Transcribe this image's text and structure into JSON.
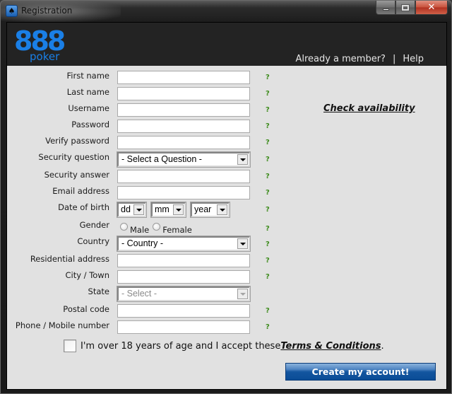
{
  "window": {
    "title": "Registration",
    "icon": "spade-icon",
    "controls": {
      "minimize": "minimize",
      "maximize": "maximize",
      "close": "close"
    }
  },
  "header": {
    "logo_number": "888",
    "logo_word": "poker",
    "brand_color": "#1a7fe6",
    "already_member": "Already a member?",
    "separator": "|",
    "help": "Help"
  },
  "form": {
    "help_glyph": "?",
    "help_color": "#3f8c1e",
    "check_availability": "Check availability",
    "fields": {
      "first_name": {
        "label": "First name",
        "value": ""
      },
      "last_name": {
        "label": "Last name",
        "value": ""
      },
      "username": {
        "label": "Username",
        "value": ""
      },
      "password": {
        "label": "Password",
        "value": ""
      },
      "verify_password": {
        "label": "Verify password",
        "value": ""
      },
      "security_question": {
        "label": "Security question",
        "selected": "- Select a Question -"
      },
      "security_answer": {
        "label": "Security answer",
        "value": ""
      },
      "email": {
        "label": "Email address",
        "value": ""
      },
      "dob": {
        "label": "Date of birth",
        "day": "dd",
        "month": "mm",
        "year": "year"
      },
      "gender": {
        "label": "Gender",
        "options": [
          "Male",
          "Female"
        ],
        "selected": null
      },
      "country": {
        "label": "Country",
        "selected": "- Country -"
      },
      "address": {
        "label": "Residential address",
        "value": ""
      },
      "city": {
        "label": "City / Town",
        "value": ""
      },
      "state": {
        "label": "State",
        "selected": "- Select -",
        "disabled": true
      },
      "postal_code": {
        "label": "Postal code",
        "value": ""
      },
      "phone": {
        "label": "Phone / Mobile number",
        "value": ""
      }
    },
    "terms": {
      "checked": false,
      "text": "I'm over 18 years of age and I accept these ",
      "link": "Terms & Conditions",
      "suffix": "."
    },
    "submit_label": "Create my account!",
    "submit_color": "#0a4c96"
  }
}
